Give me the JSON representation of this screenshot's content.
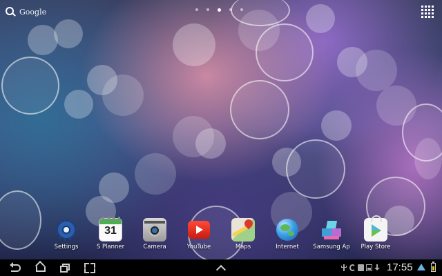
{
  "search": {
    "label": "Google"
  },
  "home_pages": {
    "count": 5,
    "active_index": 2
  },
  "dock": {
    "apps": [
      {
        "label": "Settings",
        "icon": "settings-icon"
      },
      {
        "label": "S Planner",
        "icon": "s-planner-icon",
        "calendar_day": "31"
      },
      {
        "label": "Camera",
        "icon": "camera-icon"
      },
      {
        "label": "YouTube",
        "icon": "youtube-icon"
      },
      {
        "label": "Maps",
        "icon": "maps-icon"
      },
      {
        "label": "Internet",
        "icon": "internet-icon"
      },
      {
        "label": "Samsung Ap",
        "icon": "samsung-apps-icon"
      },
      {
        "label": "Play Store",
        "icon": "play-store-icon"
      }
    ]
  },
  "status_bar": {
    "time": "17:55",
    "icons": [
      "usb-icon",
      "recycle-icon",
      "shopping-bag-icon",
      "image-icon",
      "download-icon",
      "wifi-icon",
      "battery-icon"
    ]
  },
  "navigation": {
    "buttons": [
      "back-icon",
      "home-icon",
      "recent-apps-icon",
      "screenshot-icon",
      "app-up-icon"
    ]
  },
  "colors": {
    "navbar": "#000000",
    "wifi": "#6ab0e0",
    "battery": "#e8c020"
  }
}
